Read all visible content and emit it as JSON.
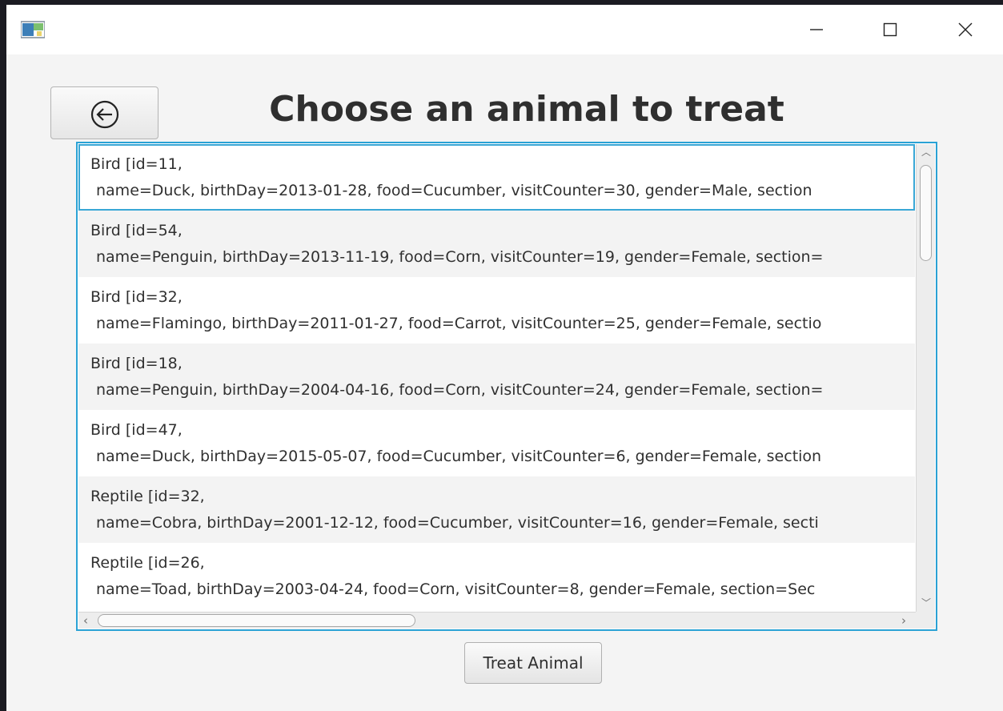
{
  "window": {
    "icon": "app-window-icon",
    "controls": {
      "minimize": "minimize-icon",
      "maximize": "maximize-icon",
      "close": "close-icon"
    }
  },
  "header": {
    "back_icon": "back-arrow-circle-icon",
    "title": "Choose an animal to treat"
  },
  "animals": [
    {
      "line1": "Bird [id=11,",
      "line2": "name=Duck, birthDay=2013-01-28, food=Cucumber, visitCounter=30, gender=Male, section"
    },
    {
      "line1": "Bird [id=54,",
      "line2": "name=Penguin, birthDay=2013-11-19, food=Corn, visitCounter=19, gender=Female, section="
    },
    {
      "line1": "Bird [id=32,",
      "line2": "name=Flamingo, birthDay=2011-01-27, food=Carrot, visitCounter=25, gender=Female, sectio"
    },
    {
      "line1": "Bird [id=18,",
      "line2": "name=Penguin, birthDay=2004-04-16, food=Corn, visitCounter=24, gender=Female, section="
    },
    {
      "line1": "Bird [id=47,",
      "line2": "name=Duck, birthDay=2015-05-07, food=Cucumber, visitCounter=6, gender=Female, section"
    },
    {
      "line1": "Reptile [id=32,",
      "line2": "name=Cobra, birthDay=2001-12-12, food=Cucumber, visitCounter=16, gender=Female, secti"
    },
    {
      "line1": "Reptile [id=26,",
      "line2": "name=Toad, birthDay=2003-04-24, food=Corn, visitCounter=8, gender=Female, section=Sec"
    }
  ],
  "selected_index": 0,
  "colors": {
    "accent": "#2aa2d5",
    "title_text": "#2f2f2f",
    "window_bg": "#f4f4f4"
  },
  "actions": {
    "treat_label": "Treat Animal"
  }
}
